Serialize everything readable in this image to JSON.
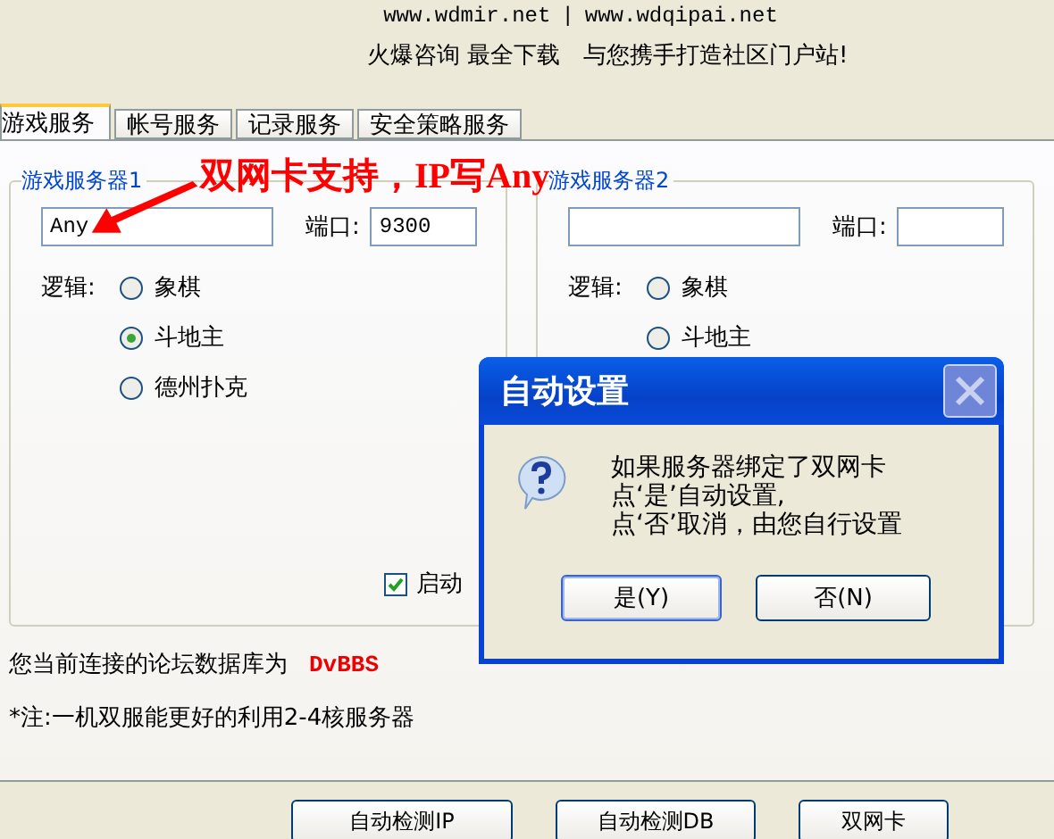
{
  "header": {
    "links": [
      "www.wdmir.net",
      "www.wdqipai.net"
    ],
    "separator": "|",
    "slogan": "火爆咨询 最全下载　与您携手打造社区门户站!"
  },
  "tabs": [
    {
      "label": "游戏服务",
      "selected": true
    },
    {
      "label": "帐号服务",
      "selected": false
    },
    {
      "label": "记录服务",
      "selected": false
    },
    {
      "label": "安全策略服务",
      "selected": false
    }
  ],
  "servers": [
    {
      "title": "游戏服务器1",
      "ip": "Any",
      "port_label": "端口:",
      "port": "9300",
      "logic_label": "逻辑:",
      "options": [
        {
          "label": "象棋",
          "selected": false
        },
        {
          "label": "斗地主",
          "selected": true
        },
        {
          "label": "德州扑克",
          "selected": false
        }
      ],
      "start": {
        "label": "启动",
        "checked": true
      }
    },
    {
      "title": "游戏服务器2",
      "port_label": "端口:",
      "logic_label": "逻辑:",
      "options": [
        {
          "label": "象棋",
          "selected": false
        },
        {
          "label": "斗地主",
          "selected": false
        }
      ]
    }
  ],
  "annotation": {
    "text": "双网卡支持，IP写Any"
  },
  "db_line": {
    "text": "您当前连接的论坛数据库为",
    "value": "DvBBS"
  },
  "note": "*注:一机双服能更好的利用2-4核服务器",
  "buttons": [
    "自动检测IP",
    "自动检测DB",
    "双网卡"
  ],
  "dialog": {
    "title": "自动设置",
    "lines": [
      "如果服务器绑定了双网卡",
      "点‘是’自动设置,",
      "点‘否’取消，由您自行设置"
    ],
    "buttons": [
      {
        "label": "是(Y)",
        "selected": true
      },
      {
        "label": "否(N)",
        "selected": false
      }
    ]
  }
}
